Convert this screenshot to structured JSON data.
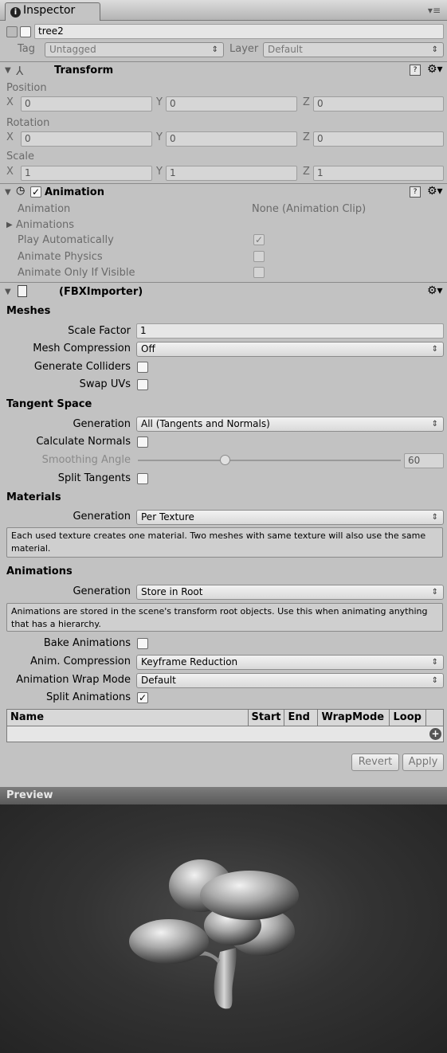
{
  "tab": {
    "title": "Inspector",
    "menu_icon": "tab-menu-icon"
  },
  "object": {
    "name": "tree2",
    "tag_label": "Tag",
    "tag_value": "Untagged",
    "layer_label": "Layer",
    "layer_value": "Default"
  },
  "transform": {
    "title": "Transform",
    "position_label": "Position",
    "rotation_label": "Rotation",
    "scale_label": "Scale",
    "axis_x": "X",
    "axis_y": "Y",
    "axis_z": "Z",
    "position": {
      "x": "0",
      "y": "0",
      "z": "0"
    },
    "rotation": {
      "x": "0",
      "y": "0",
      "z": "0"
    },
    "scale": {
      "x": "1",
      "y": "1",
      "z": "1"
    }
  },
  "animation": {
    "title": "Animation",
    "animation_label": "Animation",
    "animation_value": "None (Animation Clip)",
    "animations_label": "Animations",
    "play_auto_label": "Play Automatically",
    "animate_physics_label": "Animate Physics",
    "animate_visible_label": "Animate Only If Visible",
    "check_mark": "✓"
  },
  "importer": {
    "title": "(FBXImporter)",
    "meshes_header": "Meshes",
    "scale_factor_label": "Scale Factor",
    "scale_factor_value": "1",
    "mesh_compression_label": "Mesh Compression",
    "mesh_compression_value": "Off",
    "generate_colliders_label": "Generate Colliders",
    "swap_uvs_label": "Swap UVs",
    "tangent_header": "Tangent Space",
    "generation_label": "Generation",
    "tangent_generation_value": "All (Tangents and Normals)",
    "calc_normals_label": "Calculate Normals",
    "smoothing_angle_label": "Smoothing Angle",
    "smoothing_angle_value": "60",
    "smoothing_angle_fraction": 0.33,
    "split_tangents_label": "Split Tangents",
    "materials_header": "Materials",
    "materials_generation_value": "Per Texture",
    "materials_help": "Each used texture creates one material. Two meshes with same texture will also use the same material.",
    "animations_header": "Animations",
    "animations_generation_value": "Store in Root",
    "animations_help": "Animations are stored in the scene's transform root objects. Use this when animating anything that has a hierarchy.",
    "bake_animations_label": "Bake Animations",
    "anim_compression_label": "Anim. Compression",
    "anim_compression_value": "Keyframe Reduction",
    "wrap_mode_label": "Animation Wrap Mode",
    "wrap_mode_value": "Default",
    "split_animations_label": "Split Animations",
    "table_headers": {
      "name": "Name",
      "start": "Start",
      "end": "End",
      "wrapmode": "WrapMode",
      "loop": "Loop"
    },
    "revert_label": "Revert",
    "apply_label": "Apply"
  },
  "preview": {
    "title": "Preview"
  }
}
